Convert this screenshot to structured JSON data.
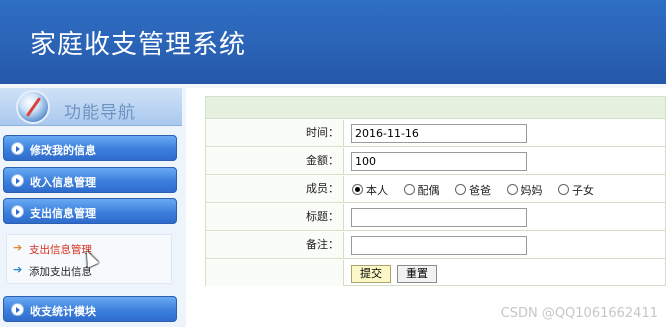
{
  "header": {
    "title": "家庭收支管理系统"
  },
  "sidebar": {
    "banner_label": "功能导航",
    "menu": [
      {
        "label": "修改我的信息"
      },
      {
        "label": "收入信息管理"
      },
      {
        "label": "支出信息管理"
      },
      {
        "label": "收支统计模块"
      }
    ],
    "submenu": [
      {
        "label": "支出信息管理",
        "color": "#d62f1f",
        "arrow_color": "#d98a2b"
      },
      {
        "label": "添加支出信息",
        "color": "#222222",
        "arrow_color": "#2a87c9"
      }
    ]
  },
  "form": {
    "time_label": "时间：",
    "time_value": "2016-11-16",
    "amount_label": "金额：",
    "amount_value": "100",
    "member_label": "成员：",
    "members": [
      {
        "label": "本人",
        "checked": true
      },
      {
        "label": "配偶",
        "checked": false
      },
      {
        "label": "爸爸",
        "checked": false
      },
      {
        "label": "妈妈",
        "checked": false
      },
      {
        "label": "子女",
        "checked": false
      }
    ],
    "title_label": "标题：",
    "title_value": "",
    "note_label": "备注：",
    "note_value": "",
    "submit_label": "提交",
    "reset_label": "重置"
  },
  "watermark": "CSDN @QQ1061662411",
  "colors": {
    "header_bg": "#2a63b6",
    "menu_bg": "#3b7fdc",
    "form_border": "#d3e0c8"
  }
}
